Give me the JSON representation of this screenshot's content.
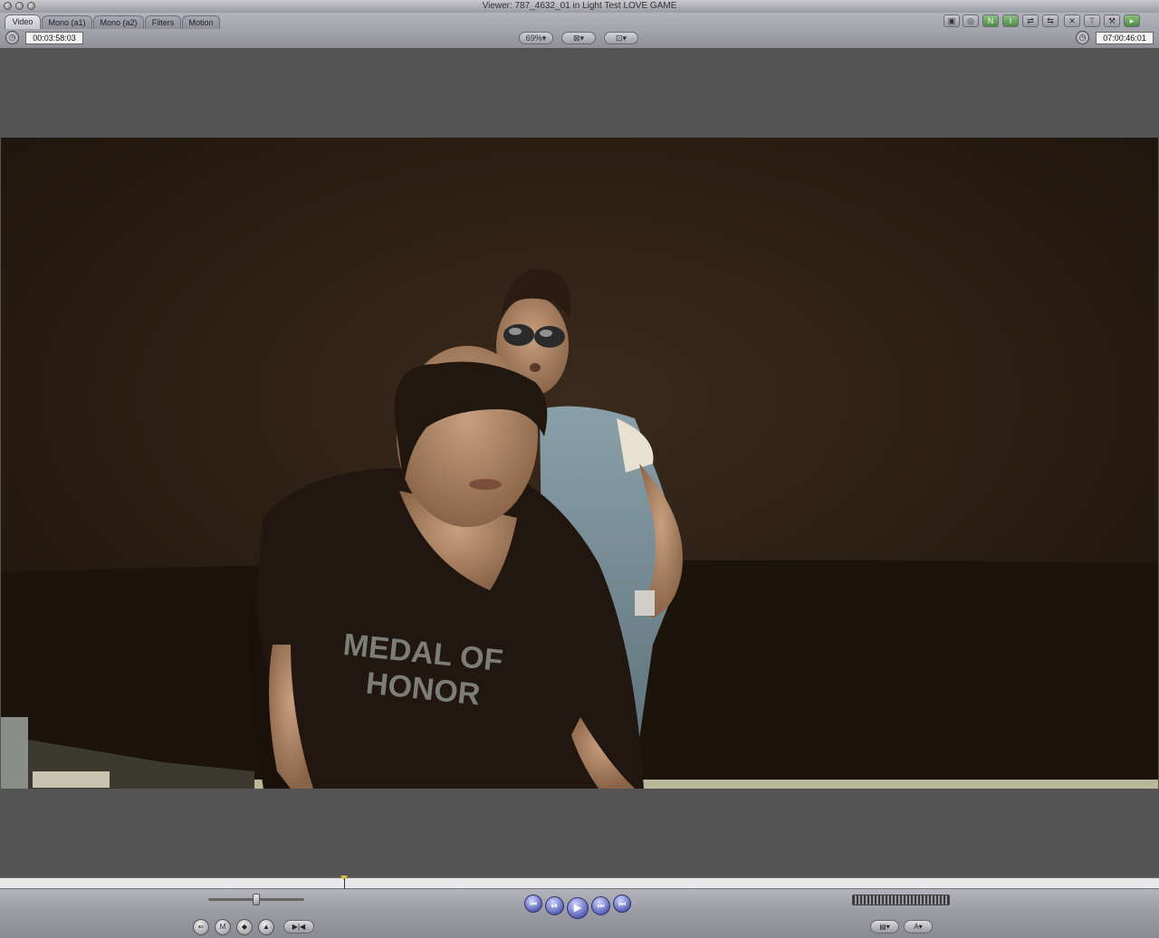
{
  "window": {
    "title": "Viewer: 787_4632_01 in Light Test LOVE GAME"
  },
  "tabs": [
    {
      "label": "Video",
      "active": true
    },
    {
      "label": "Mono (a1)",
      "active": false
    },
    {
      "label": "Mono (a2)",
      "active": false
    },
    {
      "label": "Filters",
      "active": false
    },
    {
      "label": "Motion",
      "active": false
    }
  ],
  "controls": {
    "duration_timecode": "00:03:58:03",
    "zoom": "69%",
    "view_options_icon": "view-mode-icon",
    "overlay_icon": "overlay-icon",
    "current_timecode": "07:00:46:01"
  },
  "viewer": {
    "shirt_text": "MEDAL OF HONOR"
  },
  "transport": {
    "playhead_position": 0.297,
    "shuttle_position": 0.5
  },
  "colors": {
    "accent_green": "#5a9a50",
    "play_button_blue": "#5a64b8"
  }
}
